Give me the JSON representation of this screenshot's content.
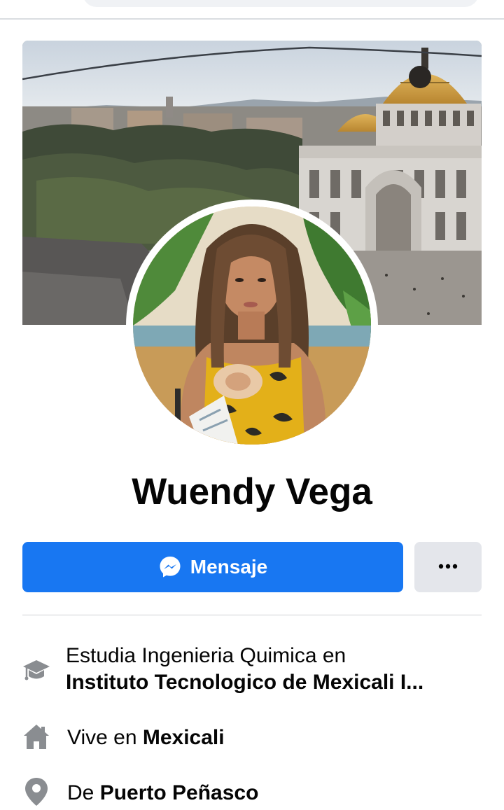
{
  "profile": {
    "name": "Wuendy Vega"
  },
  "actions": {
    "message_label": "Mensaje",
    "more_label": "•••"
  },
  "details": {
    "education": {
      "prefix": "Estudia Ingenieria Quimica en",
      "place": "Instituto Tecnologico de Mexicali I..."
    },
    "lives": {
      "prefix": "Vive en ",
      "place": "Mexicali"
    },
    "from": {
      "prefix": "De ",
      "place": "Puerto Peñasco"
    }
  },
  "icons": {
    "messenger": "messenger-icon",
    "education": "graduation-cap-icon",
    "lives": "home-icon",
    "from": "location-pin-icon",
    "more": "more-dots-icon"
  },
  "colors": {
    "primary": "#1877f2",
    "secondary_button": "#e4e6eb",
    "icon_gray": "#8a8d91",
    "text": "#050505"
  }
}
